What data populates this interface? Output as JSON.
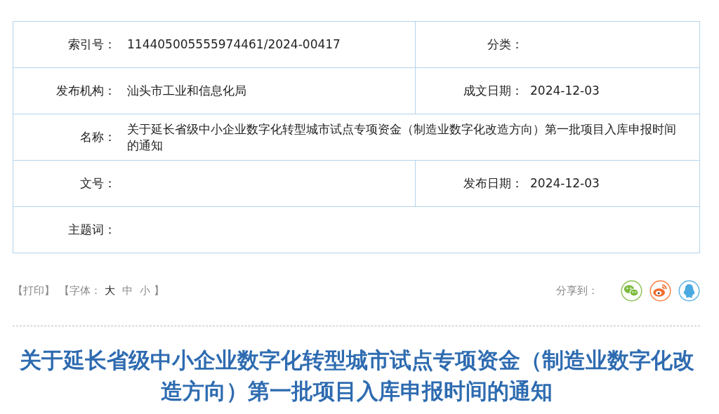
{
  "info_table": {
    "rows": [
      {
        "fields": [
          {
            "label": "索引号：",
            "value": "114405005555974461/2024-00417"
          },
          {
            "label": "分类："
          }
        ]
      },
      {
        "fields": [
          {
            "label": "发布机构：",
            "value": "汕头市工业和信息化局"
          },
          {
            "label": "成文日期：",
            "value": "2024-12-03"
          }
        ]
      },
      {
        "fields": [
          {
            "label": "名称：",
            "value": "关于延长省级中小企业数字化转型城市试点专项资金（制造业数字化改造方向）第一批项目入库申报时间的通知"
          }
        ]
      },
      {
        "fields": [
          {
            "label": "文号："
          },
          {
            "label": "发布日期：",
            "value": "2024-12-03"
          }
        ]
      },
      {
        "fields": [
          {
            "label": "主题词："
          }
        ]
      }
    ]
  },
  "toolbar": {
    "print": "【打印】",
    "font_label": "【字体：",
    "font_sizes": [
      {
        "label": "大",
        "selected": true
      },
      {
        "label": "中",
        "selected": false
      },
      {
        "label": "小",
        "selected": false
      }
    ],
    "font_close": "】",
    "share_label": "分享到：",
    "share_buttons": [
      {
        "kind": "wechat"
      },
      {
        "kind": "weibo"
      },
      {
        "kind": "qq"
      }
    ]
  },
  "article_title": "关于延长省级中小企业数字化转型城市试点专项资金（制造业数字化改造方向）第一批项目入库申报时间的通知"
}
